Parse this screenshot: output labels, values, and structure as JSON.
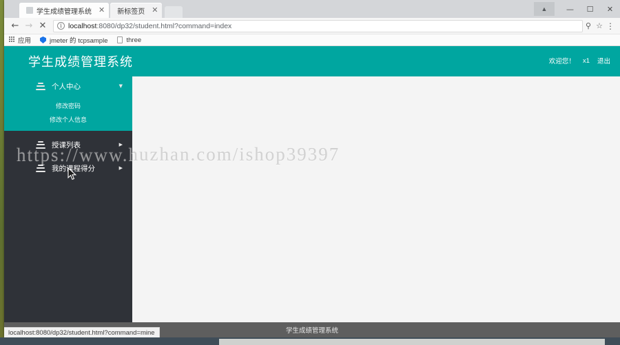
{
  "browser": {
    "tabs": [
      {
        "title": "学生成绩管理系统",
        "close": "✕",
        "active": true
      },
      {
        "title": "新标签页",
        "close": "✕",
        "active": false
      }
    ],
    "window_controls": {
      "profile": "▲",
      "minimize": "—",
      "maximize": "☐",
      "close": "✕"
    },
    "toolbar": {
      "back": "←",
      "forward": "→",
      "stop": "✕",
      "page_info": "ⓘ",
      "url_host": "localhost",
      "url_path": ":8080/dp32/student.html?command=index",
      "url_full": "localhost:8080/dp32/student.html?command=index",
      "cast_icon": "⚲",
      "bookmark_star": "☆",
      "menu": "⋮"
    },
    "bookmarks": [
      {
        "label": "应用",
        "icon": "apps-grid-icon"
      },
      {
        "label": "jmeter 的 tcpsample",
        "icon": "shield-icon"
      },
      {
        "label": "three",
        "icon": "document-icon"
      }
    ],
    "status_bubble": "localhost:8080/dp32/student.html?command=mine"
  },
  "app": {
    "title": "学生成绩管理系统",
    "header_right": {
      "welcome": "欢迎您！",
      "user": "x1",
      "logout": "退出"
    },
    "sidebar": {
      "groups": [
        {
          "label": "个人中心",
          "active": true,
          "caret": "▼",
          "submenu": [
            "修改密码",
            "修改个人信息"
          ]
        },
        {
          "label": "授课列表",
          "active": false,
          "caret": "▶",
          "submenu": []
        },
        {
          "label": "我的课程得分",
          "active": false,
          "caret": "▶",
          "submenu": []
        }
      ]
    },
    "watermark": "https://www.huzhan.com/ishop39397",
    "footer": "学生成绩管理系统"
  },
  "colors": {
    "accent_teal": "#00a6a0",
    "sidebar_dark": "#2f3238",
    "footer_gray": "#5e5e5e",
    "content_bg": "#f4f4f4"
  }
}
